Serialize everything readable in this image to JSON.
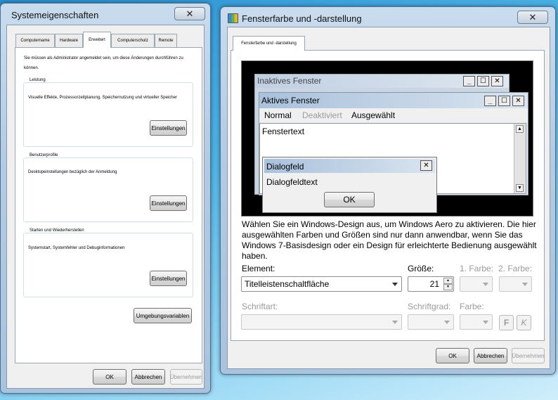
{
  "sysprops": {
    "title": "Systemeigenschaften",
    "close": "✕",
    "tabs": [
      "Computername",
      "Hardware",
      "Erweitert",
      "Computerschutz",
      "Remote"
    ],
    "admin_note": "Sie müssen als Administrator angemeldet sein, um diese Änderungen durchführen zu können.",
    "groups": [
      {
        "label": "Leistung",
        "desc": "Visuelle Effekte, Prozessorzeitplanung, Speichernutzung und virtueller Speicher",
        "button": "Einstellungen"
      },
      {
        "label": "Benutzerprofile",
        "desc": "Desktopeinstellungen bezüglich der Anmeldung",
        "button": "Einstellungen"
      },
      {
        "label": "Starten und Wiederherstellen",
        "desc": "Systemstart, Systemfehler und Debuginformationen",
        "button": "Einstellungen"
      }
    ],
    "env_button": "Umgebungsvariablen",
    "ok": "OK",
    "cancel": "Abbrechen",
    "apply": "Übernehmen"
  },
  "colors_dialog": {
    "title": "Fensterfarbe und -darstellung",
    "close": "✕",
    "tab": "Fensterfarbe und -darstellung",
    "preview": {
      "inactive_title": "Inaktives Fenster",
      "active_title": "Aktives Fenster",
      "menu_normal": "Normal",
      "menu_disabled": "Deaktiviert",
      "menu_selected": "Ausgewählt",
      "window_text": "Fenstertext",
      "dialog_title": "Dialogfeld",
      "dialog_text": "Dialogfeldtext",
      "dialog_ok": "OK",
      "min": "_",
      "max": "☐",
      "close": "✕"
    },
    "description": "Wählen Sie ein Windows-Design aus, um Windows Aero zu aktivieren. Die hier ausgewählten Farben und Größen sind nur dann anwendbar, wenn Sie das Windows 7-Basisdesign oder ein Design für erleichterte Bedienung ausgewählt haben.",
    "element_label": "Element:",
    "element_value": "Titelleistenschaltfläche",
    "size_label": "Größe:",
    "size_value": "21",
    "color1_label": "1. Farbe:",
    "color2_label": "2. Farbe:",
    "font_label": "Schriftart:",
    "fontsize_label": "Schriftgrad:",
    "color_label": "Farbe:",
    "bold": "F",
    "italic": "K",
    "ok": "OK",
    "cancel": "Abbrechen",
    "apply": "Übernehmen"
  }
}
